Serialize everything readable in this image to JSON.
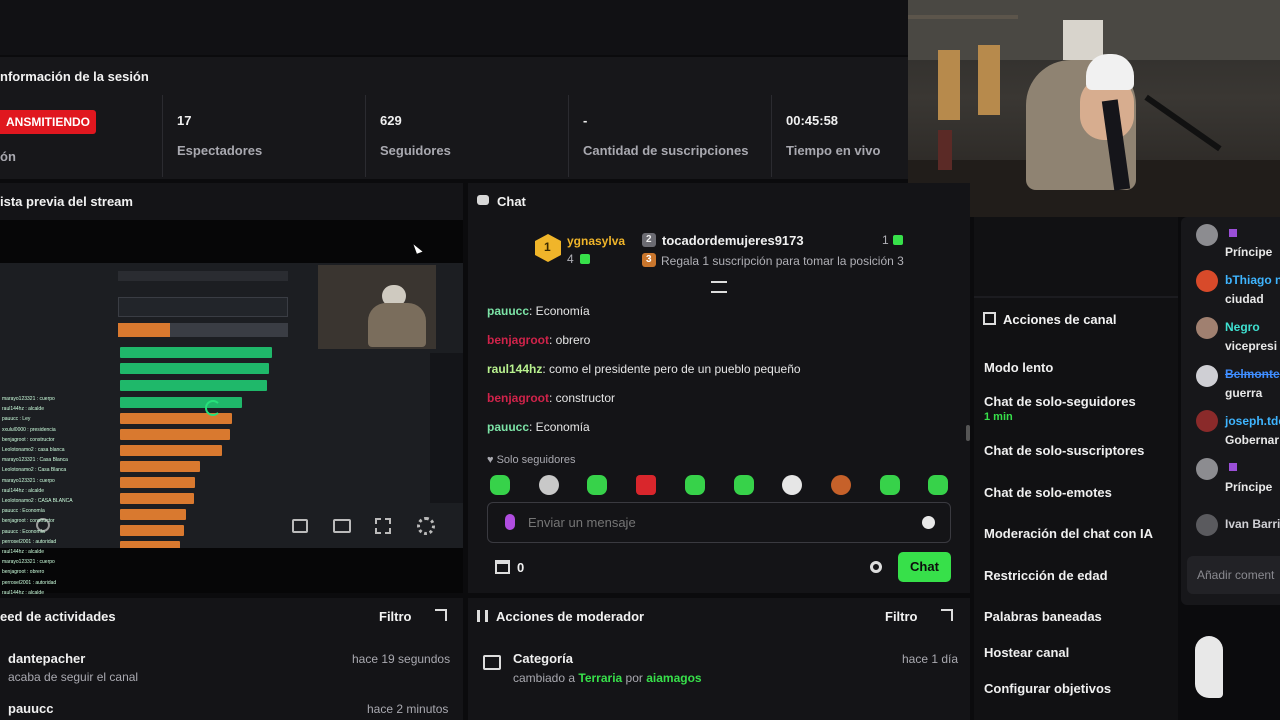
{
  "session": {
    "title": "nformación de la sesión",
    "live_badge": "ANSMITIENDO",
    "live_sub": "ón",
    "stats": [
      {
        "value": "17",
        "label": "Espectadores"
      },
      {
        "value": "629",
        "label": "Seguidores"
      },
      {
        "value": "-",
        "label": "Cantidad de suscripciones"
      },
      {
        "value": "00:45:58",
        "label": "Tiempo en vivo"
      }
    ]
  },
  "preview": {
    "title": "ista previa del stream"
  },
  "preview_overlay": {
    "rows": [
      "marayo123321 : cuerpo",
      "raul144hz : alcalde",
      "pauucc : Ley",
      "xxulul0000 : presidencia",
      "benjagroot : constructor",
      "Leolotonamo2 : casa blanca",
      "marayo123321 : Casa Blanca",
      "Leolotonamo2 : Casa Blanca",
      "marayo123321 : cuerpo",
      "raul144hz : alcalde",
      "Leolotonamo2 : CASA BLANCA",
      "pauucc : Economía",
      "benjagroot : constructor",
      "pauucc : Economía",
      "perrosel2001 : autoridad",
      "raul144hz : alcalde",
      "marayo123321 : cuerpo",
      "benjagroot : obrero",
      "perrosel2001 : autoridad",
      "raul144hz : alcalde",
      "pauucc : Economía",
      "perrosel2001 : autoridad",
      "FF_deroo : lider",
      "FF_deroo : lider",
      "benjagroot : obrero",
      "perrosel2001 : autoridad",
      "pauucc : Economía",
      "perrosel2001 : autoridad",
      "benjagroot : obrero",
      "raul144hz : como el presidente pero de un pueblo pequeño",
      "pauucc : Economía"
    ]
  },
  "chat": {
    "title": "Chat",
    "leader1": {
      "rank": "1",
      "name": "ygnasylva",
      "count": "4"
    },
    "leader2": {
      "rank": "2",
      "name": "tocadordemujeres9173",
      "count": "1"
    },
    "leader3": {
      "rank": "3",
      "text": "Regala 1 suscripción para tomar la posición 3"
    },
    "messages": [
      {
        "user": "pauucc",
        "text": ": Economía",
        "color": "#7ce3a6"
      },
      {
        "user": "benjagroot",
        "text": ": obrero",
        "color": "#d0234a"
      },
      {
        "user": "raul144hz",
        "text": ": como el presidente pero de un pueblo pequeño",
        "color": "#b9f28f"
      },
      {
        "user": "benjagroot",
        "text": ": constructor",
        "color": "#d0234a"
      },
      {
        "user": "pauucc",
        "text": ": Economía",
        "color": "#7ce3a6"
      }
    ],
    "followers_only": "Solo seguidores",
    "input_placeholder": "Enviar un mensaje",
    "points": "0",
    "send_label": "Chat"
  },
  "feed": {
    "title": "eed de actividades",
    "filter": "Filtro",
    "items": [
      {
        "user": "dantepacher",
        "action": "acaba de seguir el canal",
        "time": "hace 19 segundos"
      },
      {
        "user": "pauucc",
        "action": "",
        "time": "hace 2 minutos"
      }
    ]
  },
  "mod_actions": {
    "title": "Acciones de moderador",
    "filter": "Filtro",
    "item": {
      "label": "Categoría",
      "prefix": "cambiado a",
      "category": "Terraria",
      "by": "por",
      "moderator": "aiamagos",
      "time": "hace 1 día"
    }
  },
  "channel_actions": {
    "title": "Acciones de canal",
    "items": [
      "Modo lento",
      "Chat de solo-seguidores",
      "Chat de solo-suscriptores",
      "Chat de solo-emotes",
      "Moderación del chat con IA",
      "Restricción de edad",
      "Palabras baneadas",
      "Hostear canal",
      "Configurar objetivos"
    ],
    "followers_sub": "1 min"
  },
  "side_chat": {
    "rows": [
      {
        "user": "",
        "text": "Príncipe"
      },
      {
        "user": "bThiago n",
        "text": "ciudad"
      },
      {
        "user": "Negro",
        "text": "vicepresi"
      },
      {
        "user": "Belmonte",
        "text": "guerra"
      },
      {
        "user": "joseph.tde",
        "text": "Gobernar"
      },
      {
        "user": "",
        "text": "Príncipe"
      },
      {
        "user": "Ivan Barri",
        "text": ""
      }
    ],
    "input_placeholder": "Añadir coment"
  },
  "colors": {
    "accent": "#37e04a",
    "live": "#e0171f",
    "bar_green": "#1fb86a",
    "bar_orange": "#d9792f"
  }
}
